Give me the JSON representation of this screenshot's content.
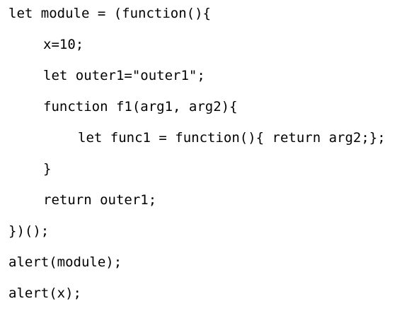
{
  "code": {
    "lines": [
      "let module = (function(){",
      "x=10;",
      "let outer1=\"outer1\";",
      "function f1(arg1, arg2){",
      "let func1 = function(){ return arg2;};",
      "}",
      "return outer1;",
      "})();",
      "alert(module);",
      "alert(x);"
    ]
  }
}
